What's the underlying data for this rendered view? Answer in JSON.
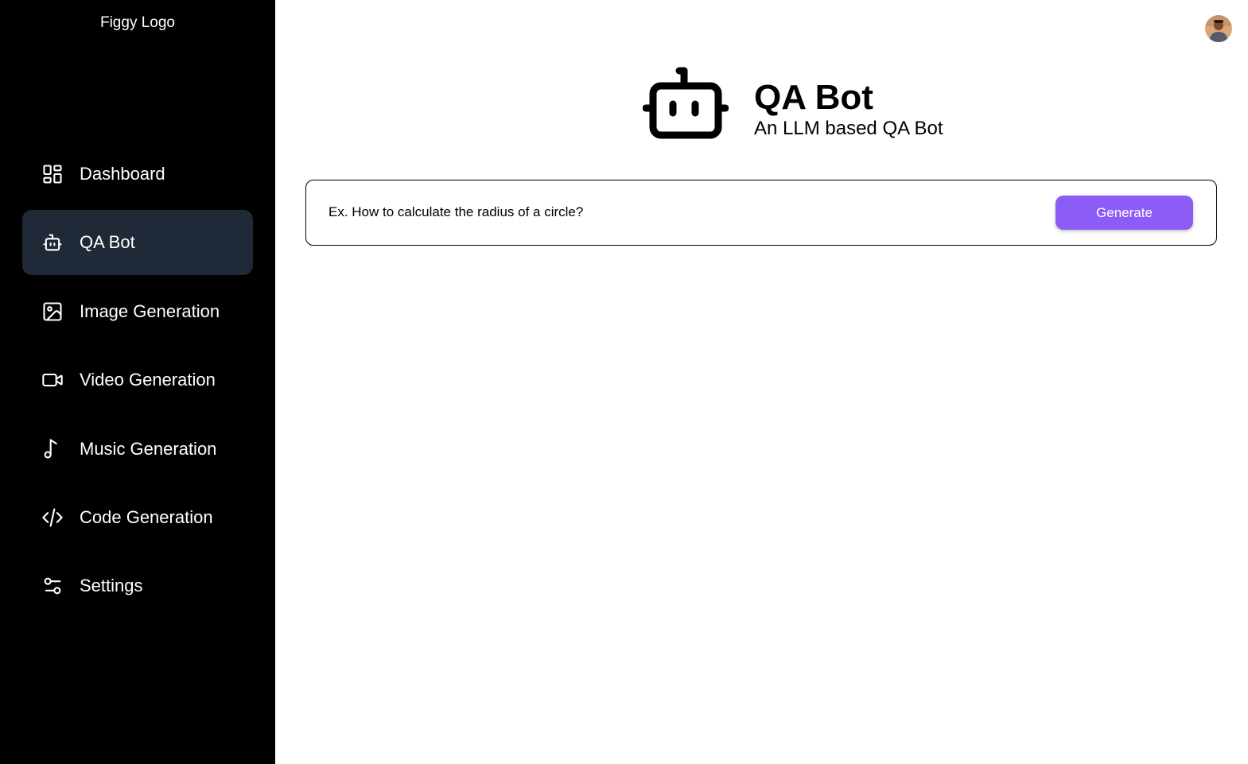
{
  "sidebar": {
    "logo": "Figgy Logo",
    "items": [
      {
        "label": "Dashboard",
        "icon": "dashboard-icon",
        "active": false
      },
      {
        "label": "QA Bot",
        "icon": "bot-icon",
        "active": true
      },
      {
        "label": "Image Generation",
        "icon": "image-icon",
        "active": false
      },
      {
        "label": "Video Generation",
        "icon": "video-icon",
        "active": false
      },
      {
        "label": "Music Generation",
        "icon": "music-note-icon",
        "active": false
      },
      {
        "label": "Code Generation",
        "icon": "code-icon",
        "active": false
      },
      {
        "label": "Settings",
        "icon": "settings-sliders-icon",
        "active": false
      }
    ]
  },
  "header": {
    "avatar_icon": "user-avatar"
  },
  "hero": {
    "icon": "bot-icon",
    "title": "QA Bot",
    "subtitle": "An LLM based QA Bot"
  },
  "prompt": {
    "placeholder": "Ex. How to calculate the radius of a circle?",
    "value": "",
    "button_label": "Generate"
  },
  "colors": {
    "sidebar_bg": "#000000",
    "active_item_bg": "#1f2937",
    "accent": "#8b5cf6",
    "text_light": "#ffffff",
    "text_dark": "#000000"
  }
}
